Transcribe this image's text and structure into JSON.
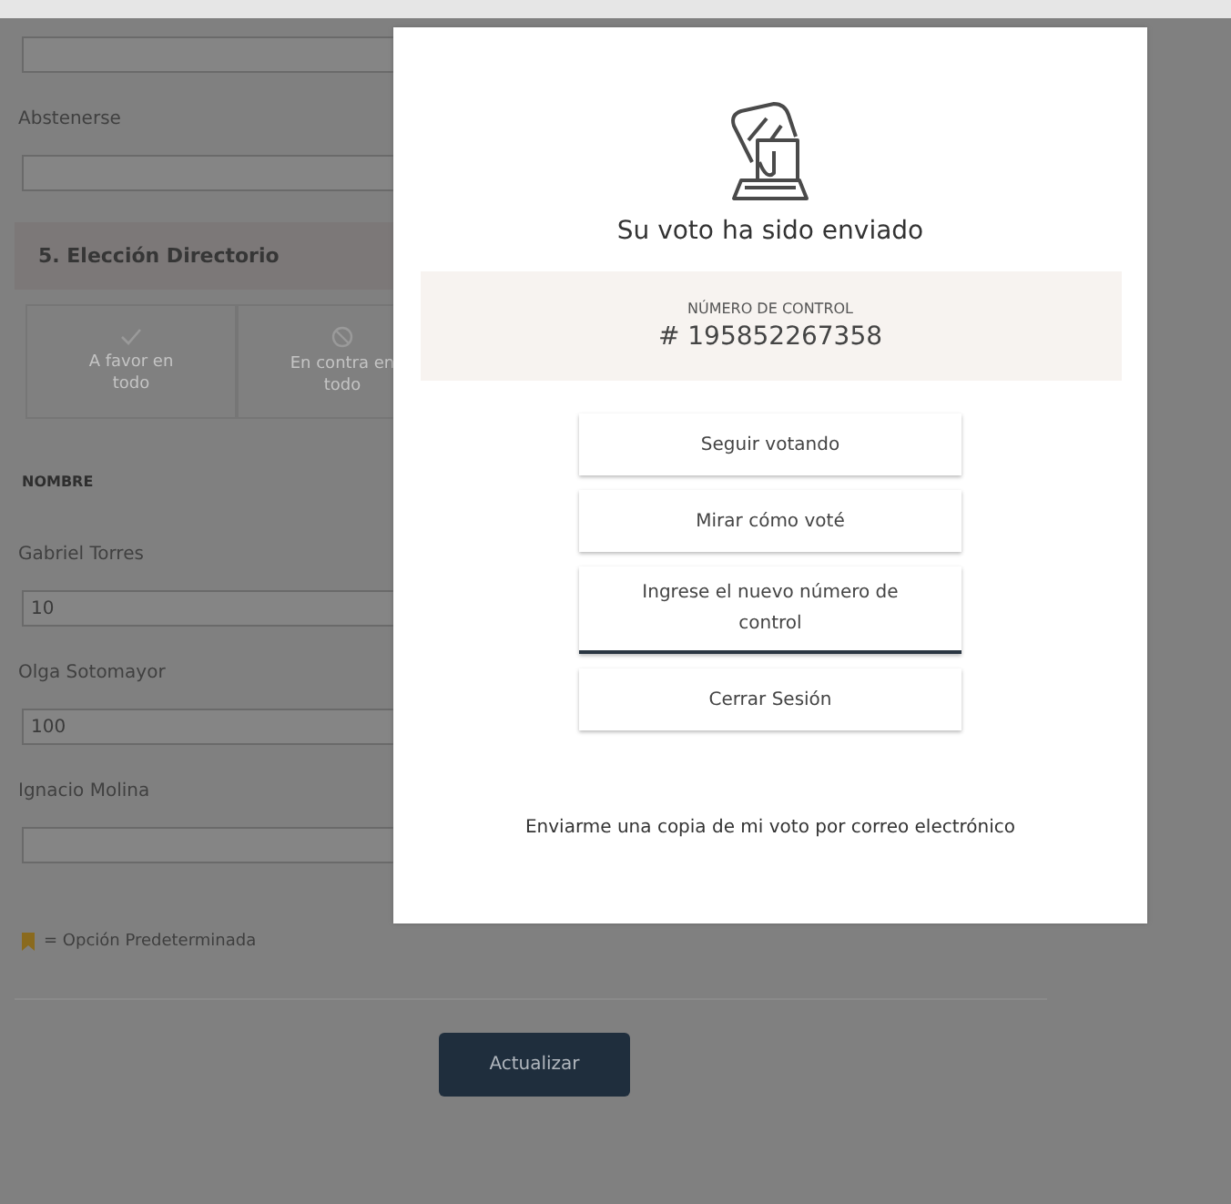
{
  "form": {
    "fields": [
      {
        "kind": "text"
      },
      {
        "kind": "text",
        "label": "Abstenerse"
      }
    ],
    "section": {
      "title": "5. Elección Directorio",
      "bulk_options": [
        {
          "kind": "favor",
          "label": "A favor en todo"
        },
        {
          "kind": "contra",
          "label": "En contra en todo"
        }
      ]
    },
    "column_heading": "NOMBRE",
    "candidates": [
      {
        "name": "Gabriel Torres",
        "value": "10"
      },
      {
        "name": "Olga Sotomayor",
        "value": "100"
      },
      {
        "name": "Ignacio Molina"
      }
    ],
    "legend": "= Opción Predeterminada",
    "submit_button": "Actualizar"
  },
  "dialog": {
    "title": "Su voto ha sido enviado",
    "control_label": "NÚMERO DE CONTROL",
    "control_number": "# 195852267358",
    "actions": [
      {
        "label": "Seguir votando",
        "selected": false
      },
      {
        "label": "Mirar cómo voté",
        "selected": false
      },
      {
        "label": "Ingrese el nuevo número de control",
        "selected": true
      },
      {
        "label": "Cerrar Sesión",
        "selected": false
      }
    ],
    "email_link": "Enviarme una copia de mi voto por correo electrónico"
  }
}
